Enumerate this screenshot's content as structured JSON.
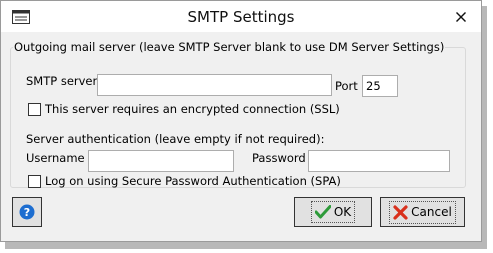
{
  "window": {
    "title": "SMTP Settings",
    "icons": {
      "app": "window-icon",
      "close": "close-icon"
    }
  },
  "outgoing": {
    "legend": "Outgoing mail server (leave SMTP Server blank to use DM Server Settings)",
    "smtp_server_label": "SMTP server",
    "smtp_server_value": "",
    "port_label": "Port",
    "port_value": "25",
    "ssl_label": "This server requires an encrypted connection (SSL)",
    "ssl_checked": false
  },
  "auth": {
    "heading": "Server authentication (leave empty if not required):",
    "username_label": "Username",
    "username_value": "",
    "password_label": "Password",
    "password_value": "",
    "spa_label": "Log on using Secure Password Authentication (SPA)",
    "spa_checked": false
  },
  "buttons": {
    "help_icon": "help-icon",
    "ok_label": "OK",
    "ok_icon": "checkmark-icon",
    "cancel_label": "Cancel",
    "cancel_icon": "cross-icon"
  },
  "colors": {
    "help_blue": "#1c6dd0",
    "ok_green": "#2e9b3a",
    "cancel_red": "#d9301c"
  }
}
